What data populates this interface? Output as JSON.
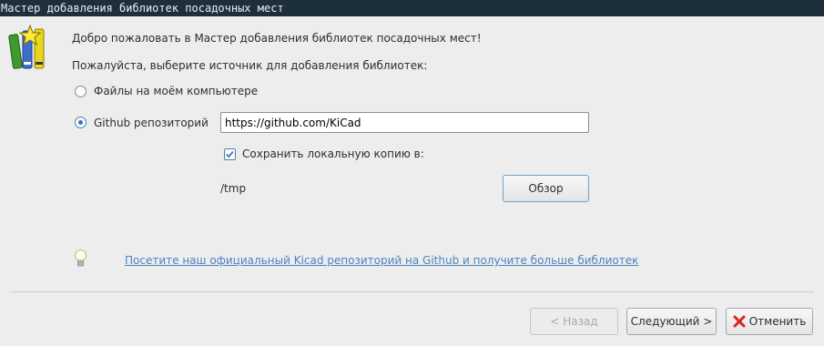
{
  "window": {
    "title": "Мастер добавления библиотек посадочных мест"
  },
  "intro": {
    "welcome": "Добро пожаловать в Мастер добавления библиотек посадочных мест!",
    "prompt": "Пожалуйста, выберите источник для добавления библиотек:"
  },
  "source": {
    "local_label": "Файлы на моём компьютере",
    "local_selected": false,
    "github_label": "Github репозиторий",
    "github_selected": true,
    "github_url": "https://github.com/KiCad",
    "save_local_label": "Сохранить локальную копию в:",
    "save_local_checked": true,
    "local_path": "/tmp",
    "browse_label": "Обзор"
  },
  "tip": {
    "link_text": "Посетите наш официальный Kicad репозиторий на Github и получите больше библиотек",
    "icon": "lightbulb-icon"
  },
  "footer": {
    "back_label": "< Назад",
    "next_label": "Следующий >",
    "cancel_label": "Отменить",
    "cancel_icon": "close-icon"
  },
  "colors": {
    "titlebar": "#1e2f3c",
    "accent": "#3b73b3",
    "link": "#4d83c0",
    "cancel_icon": "#d9261c"
  }
}
